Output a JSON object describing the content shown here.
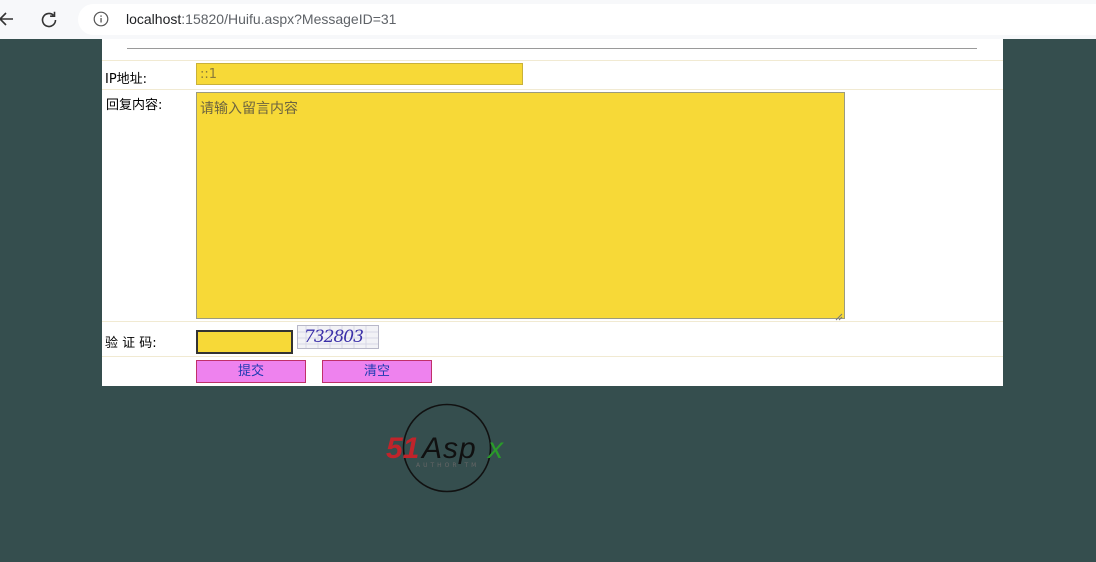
{
  "browser": {
    "url_host": "localhost",
    "url_rest": ":15820/Huifu.aspx?MessageID=31"
  },
  "form": {
    "ip_label": "IP地址:",
    "ip_value": "::1",
    "reply_label": "回复内容:",
    "reply_placeholder": "请输入留言内容",
    "captcha_label": "验 证 码:",
    "captcha_value": "",
    "captcha_image_text": "732803",
    "submit_label": "提交",
    "clear_label": "清空"
  },
  "logo": {
    "brand_red": "51",
    "brand_dark": "Asp",
    "brand_green": "x",
    "tagline": "AUTHOR TM"
  },
  "colors": {
    "page_background": "#354e4e",
    "input_background": "#f7d937",
    "button_background": "#ee82ee"
  }
}
